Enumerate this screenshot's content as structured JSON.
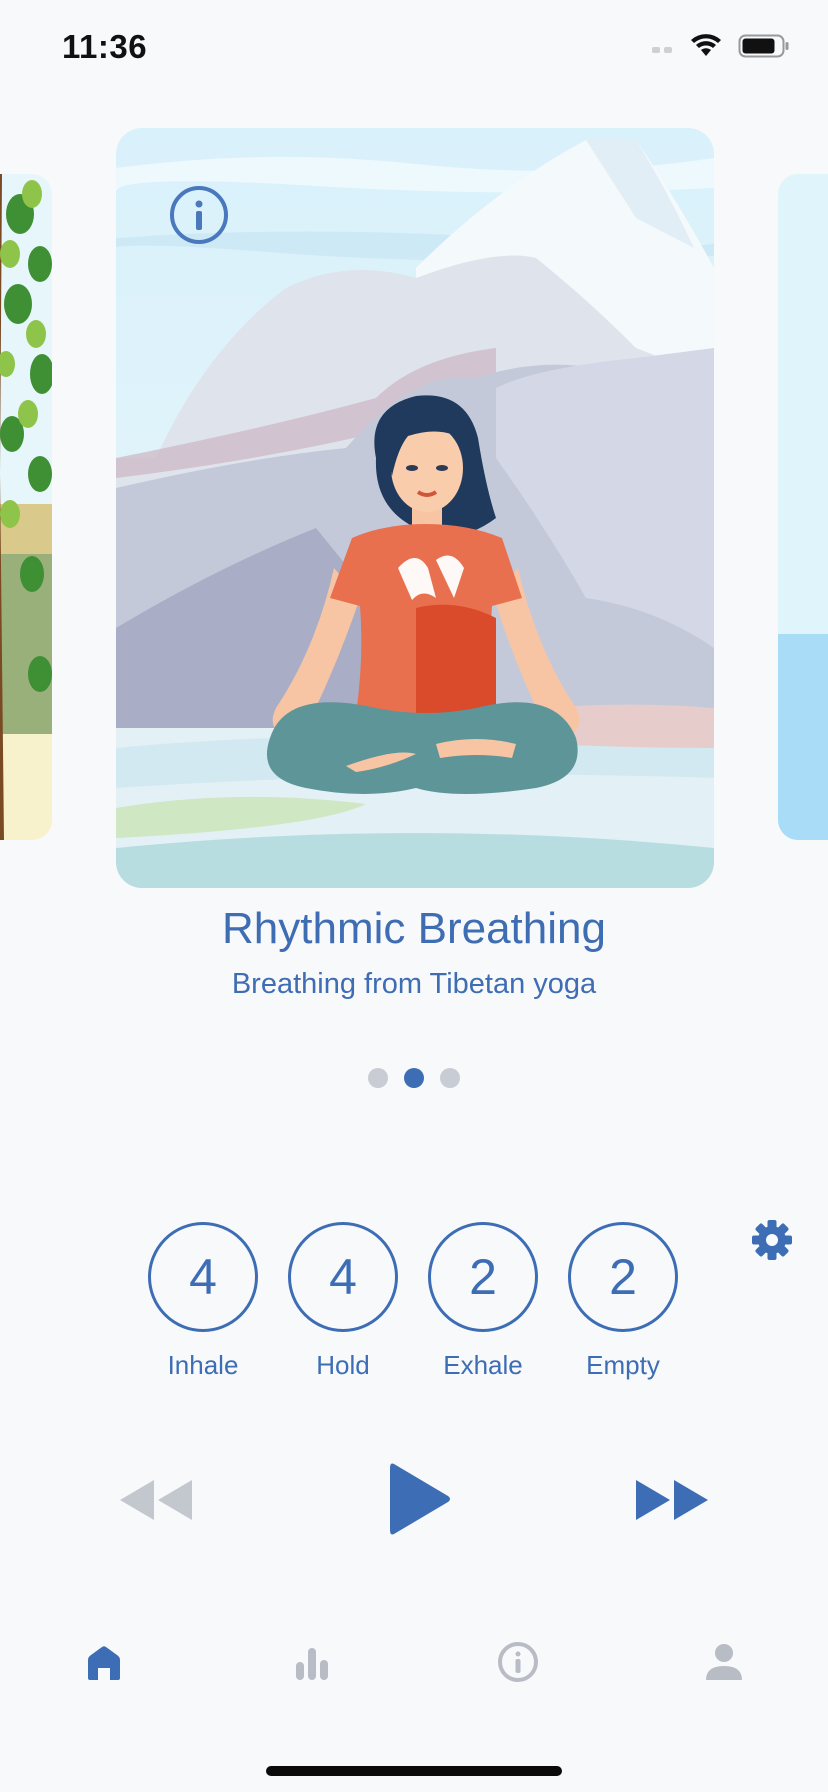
{
  "status_bar": {
    "time": "11:36"
  },
  "carousel": {
    "title": "Rhythmic Breathing",
    "subtitle": "Breathing from Tibetan yoga",
    "page_count": 3,
    "active_page": 2
  },
  "breath_pattern": [
    {
      "value": "4",
      "label": "Inhale"
    },
    {
      "value": "4",
      "label": "Hold"
    },
    {
      "value": "2",
      "label": "Exhale"
    },
    {
      "value": "2",
      "label": "Empty"
    }
  ],
  "tabs": [
    "home-icon",
    "stats-icon",
    "info-icon",
    "profile-icon"
  ],
  "colors": {
    "accent": "#3d6db4",
    "inactive": "#b8bcc4",
    "shirt": "#e8704f"
  }
}
